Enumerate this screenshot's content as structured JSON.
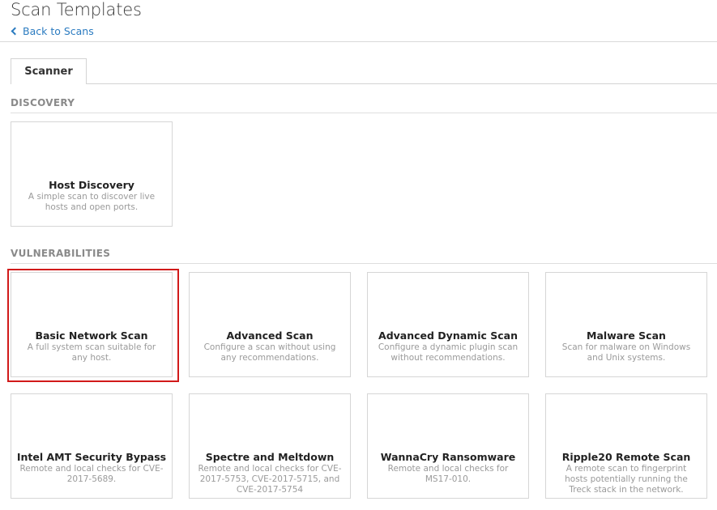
{
  "page": {
    "title": "Scan Templates",
    "back_link": "Back to Scans"
  },
  "tabs": [
    {
      "label": "Scanner"
    }
  ],
  "sections": {
    "discovery": {
      "title": "DISCOVERY",
      "cards": [
        {
          "title": "Host Discovery",
          "desc": "A simple scan to discover live hosts and open ports."
        }
      ]
    },
    "vulnerabilities": {
      "title": "VULNERABILITIES",
      "cards": [
        {
          "title": "Basic Network Scan",
          "desc": "A full system scan suitable for any host."
        },
        {
          "title": "Advanced Scan",
          "desc": "Configure a scan without using any recommendations."
        },
        {
          "title": "Advanced Dynamic Scan",
          "desc": "Configure a dynamic plugin scan without recommendations."
        },
        {
          "title": "Malware Scan",
          "desc": "Scan for malware on Windows and Unix systems."
        },
        {
          "title": "Intel AMT Security Bypass",
          "desc": "Remote and local checks for CVE-2017-5689."
        },
        {
          "title": "Spectre and Meltdown",
          "desc": "Remote and local checks for CVE-2017-5753, CVE-2017-5715, and CVE-2017-5754"
        },
        {
          "title": "WannaCry Ransomware",
          "desc": "Remote and local checks for MS17-010."
        },
        {
          "title": "Ripple20 Remote Scan",
          "desc": "A remote scan to fingerprint hosts potentially running the Treck stack in the network."
        }
      ]
    }
  },
  "colors": {
    "link": "#2b7bc0",
    "highlight": "#d11a1a"
  }
}
